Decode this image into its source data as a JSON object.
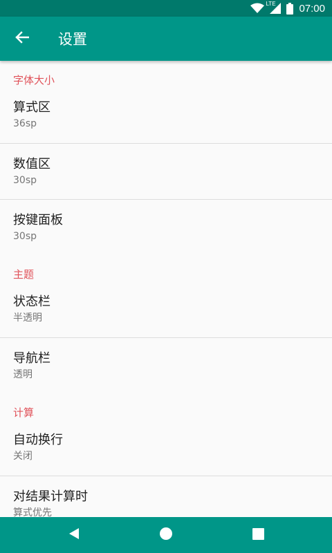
{
  "status_bar": {
    "network_label": "LTE",
    "time": "07:00"
  },
  "app_bar": {
    "title": "设置"
  },
  "sections": [
    {
      "header": "字体大小",
      "items": [
        {
          "title": "算式区",
          "summary": "36sp"
        },
        {
          "title": "数值区",
          "summary": "30sp"
        },
        {
          "title": "按键面板",
          "summary": "30sp"
        }
      ]
    },
    {
      "header": "主题",
      "items": [
        {
          "title": "状态栏",
          "summary": "半透明"
        },
        {
          "title": "导航栏",
          "summary": "透明"
        }
      ]
    },
    {
      "header": "计算",
      "items": [
        {
          "title": "自动换行",
          "summary": "关闭"
        },
        {
          "title": "对结果计算时",
          "summary": "算式优先"
        }
      ]
    }
  ],
  "colors": {
    "status_bar": "#00796b",
    "app_bar": "#009688",
    "category_accent": "#e0525a",
    "background": "#fafafa"
  }
}
